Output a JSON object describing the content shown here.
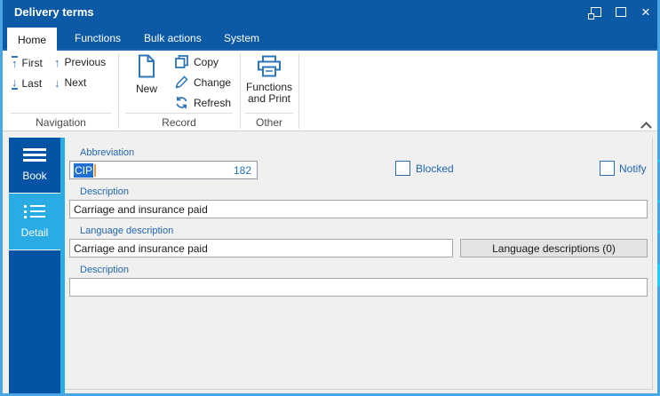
{
  "window": {
    "title": "Delivery terms",
    "controls": {
      "restore_icon": "restore-window",
      "maximize_icon": "maximize-window",
      "close_glyph": "×"
    }
  },
  "tabs": [
    {
      "label": "Home",
      "active": true
    },
    {
      "label": "Functions",
      "active": false
    },
    {
      "label": "Bulk actions",
      "active": false
    },
    {
      "label": "System",
      "active": false
    }
  ],
  "ribbon": {
    "groups": [
      {
        "label": "Navigation",
        "items": [
          {
            "label": "First",
            "glyph": "↑"
          },
          {
            "label": "Previous",
            "glyph": "↑"
          },
          {
            "label": "Last",
            "glyph": "↓"
          },
          {
            "label": "Next",
            "glyph": "↓"
          }
        ]
      },
      {
        "label": "Record",
        "items": [
          {
            "label": "New",
            "icon": "new-document-icon"
          },
          {
            "label": "Copy",
            "icon": "copy-icon"
          },
          {
            "label": "Change",
            "icon": "pencil-icon"
          },
          {
            "label": "Refresh",
            "icon": "refresh-icon"
          }
        ]
      },
      {
        "label": "Other",
        "items": [
          {
            "label": "Functions and Print",
            "icon": "printer-icon"
          }
        ]
      }
    ]
  },
  "sidebar": {
    "items": [
      {
        "label": "Book",
        "icon": "book-menu-icon",
        "selected": false
      },
      {
        "label": "Detail",
        "icon": "detail-list-icon",
        "selected": true
      }
    ]
  },
  "form": {
    "abbreviation": {
      "label": "Abbreviation",
      "value": "CIP",
      "number": "182"
    },
    "blocked": {
      "label": "Blocked",
      "checked": false
    },
    "notify": {
      "label": "Notify",
      "checked": false
    },
    "description": {
      "label": "Description",
      "value": "Carriage and insurance paid"
    },
    "language_description": {
      "label": "Language description",
      "value": "Carriage and insurance paid"
    },
    "language_descriptions_button": {
      "label": "Language descriptions (0)"
    },
    "description2": {
      "label": "Description",
      "value": ""
    }
  },
  "colors": {
    "titlebar_blue": "#0c5aa5",
    "sidebar_blue": "#0553a4",
    "selected_cyan": "#29abe4",
    "window_border_blue": "#4aa5e6",
    "label_blue": "#2166b0",
    "ribbon_icon_blue": "#2e74b8",
    "selection_blue": "#1f70d0",
    "caret_orange": "#e09a3c",
    "content_gray": "#f0f0f0"
  }
}
